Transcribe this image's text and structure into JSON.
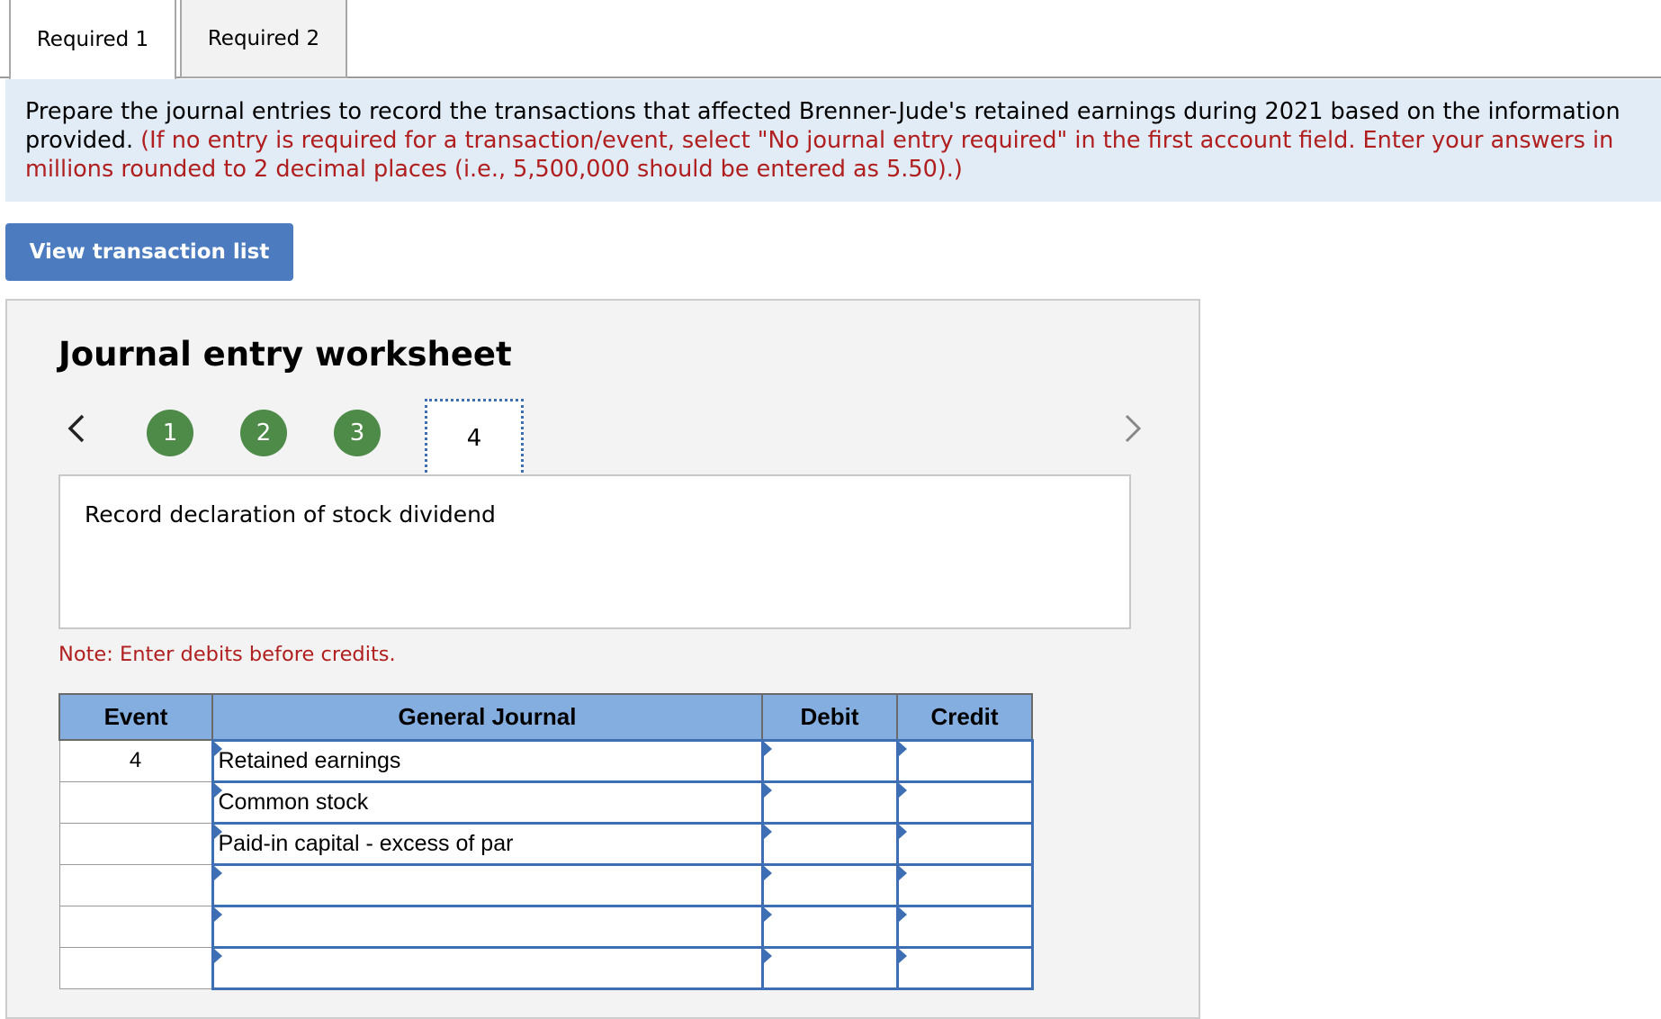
{
  "tabs": [
    {
      "label": "Required 1",
      "active": true
    },
    {
      "label": "Required 2",
      "active": false
    }
  ],
  "instructions": {
    "main": "Prepare the journal entries to record the transactions that affected Brenner-Jude's retained earnings during 2021 based on the information provided.",
    "red": "(If no entry is required for a transaction/event, select \"No journal entry required\" in the first account field. Enter your answers in millions rounded to 2 decimal places (i.e., 5,500,000 should be entered as 5.50).)"
  },
  "view_button_label": "View transaction list",
  "worksheet": {
    "title": "Journal entry worksheet",
    "steps": [
      "1",
      "2",
      "3"
    ],
    "current_step": "4",
    "description": "Record declaration of stock dividend",
    "note": "Note: Enter debits before credits."
  },
  "journal": {
    "headers": {
      "event": "Event",
      "general_journal": "General Journal",
      "debit": "Debit",
      "credit": "Credit"
    },
    "rows": [
      {
        "event": "4",
        "account": "Retained earnings",
        "debit": "",
        "credit": ""
      },
      {
        "event": "",
        "account": "Common stock",
        "debit": "",
        "credit": ""
      },
      {
        "event": "",
        "account": "Paid-in capital - excess of par",
        "debit": "",
        "credit": ""
      },
      {
        "event": "",
        "account": "",
        "debit": "",
        "credit": ""
      },
      {
        "event": "",
        "account": "",
        "debit": "",
        "credit": ""
      },
      {
        "event": "",
        "account": "",
        "debit": "",
        "credit": ""
      }
    ]
  },
  "colors": {
    "accent_blue": "#4c7cbf",
    "header_blue": "#85aee0",
    "step_green": "#4e8a48",
    "instruction_bg": "#e1ecf7",
    "warning_red": "#b01e1e"
  },
  "icons": {
    "prev": "chevron-left-icon",
    "next": "chevron-right-icon"
  }
}
